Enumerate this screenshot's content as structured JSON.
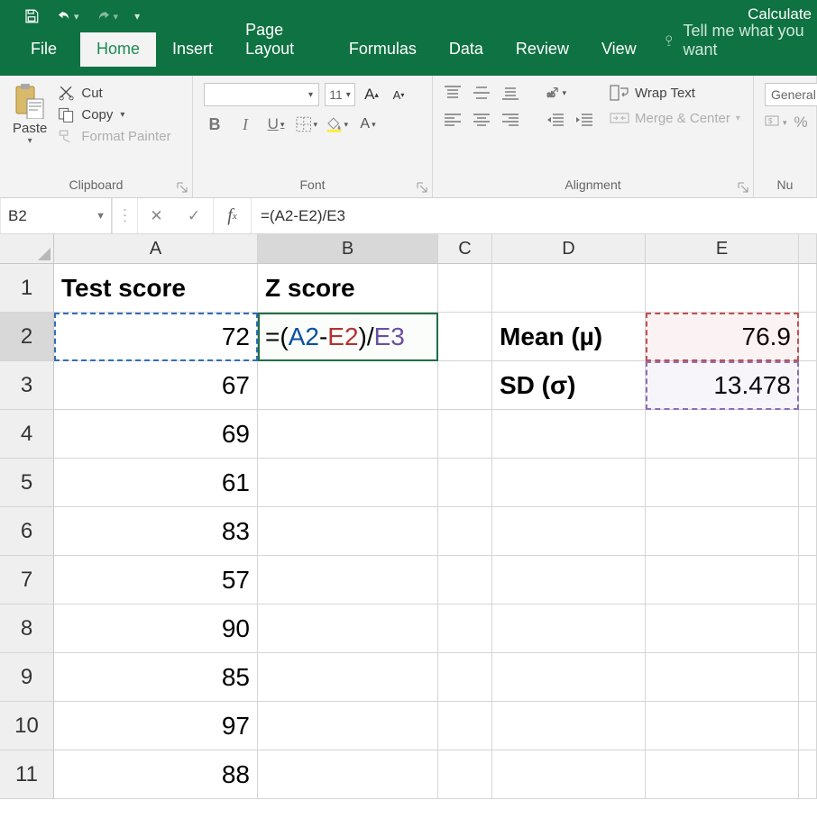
{
  "title_right": "Calculate",
  "tabs": {
    "file": "File",
    "home": "Home",
    "insert": "Insert",
    "page_layout": "Page Layout",
    "formulas": "Formulas",
    "data": "Data",
    "review": "Review",
    "view": "View",
    "tell_me": "Tell me what you want"
  },
  "ribbon": {
    "clipboard": {
      "paste": "Paste",
      "cut": "Cut",
      "copy": "Copy",
      "format_painter": "Format Painter",
      "label": "Clipboard"
    },
    "font": {
      "name": "",
      "size": "11",
      "label": "Font"
    },
    "alignment": {
      "wrap": "Wrap Text",
      "merge": "Merge & Center",
      "label": "Alignment"
    },
    "number": {
      "format": "General",
      "label": "Nu"
    }
  },
  "formula_bar": {
    "name_box": "B2",
    "formula": "=(A2-E2)/E3"
  },
  "grid": {
    "columns": [
      "A",
      "B",
      "C",
      "D",
      "E"
    ],
    "rows": [
      "1",
      "2",
      "3",
      "4",
      "5",
      "6",
      "7",
      "8",
      "9",
      "10",
      "11"
    ],
    "active_cell": "B2",
    "headers": {
      "A1": "Test score",
      "B1": "Z score"
    },
    "b2_formula": {
      "pre": "=(",
      "a": "A2",
      "m1": "-",
      "e": "E2",
      "m2": ")/",
      "e3": "E3"
    },
    "d2": "Mean (µ)",
    "d3": "SD (σ)",
    "e2": "76.9",
    "e3": "13.478",
    "colA_values": [
      "72",
      "67",
      "69",
      "61",
      "83",
      "57",
      "90",
      "85",
      "97",
      "88"
    ]
  },
  "chart_data": {
    "type": "table",
    "title": "Z score computation",
    "columns": [
      "Test score"
    ],
    "rows": [
      72,
      67,
      69,
      61,
      83,
      57,
      90,
      85,
      97,
      88
    ],
    "stats": {
      "mean": 76.9,
      "sd": 13.478
    },
    "formula_in_B2": "=(A2-E2)/E3"
  }
}
